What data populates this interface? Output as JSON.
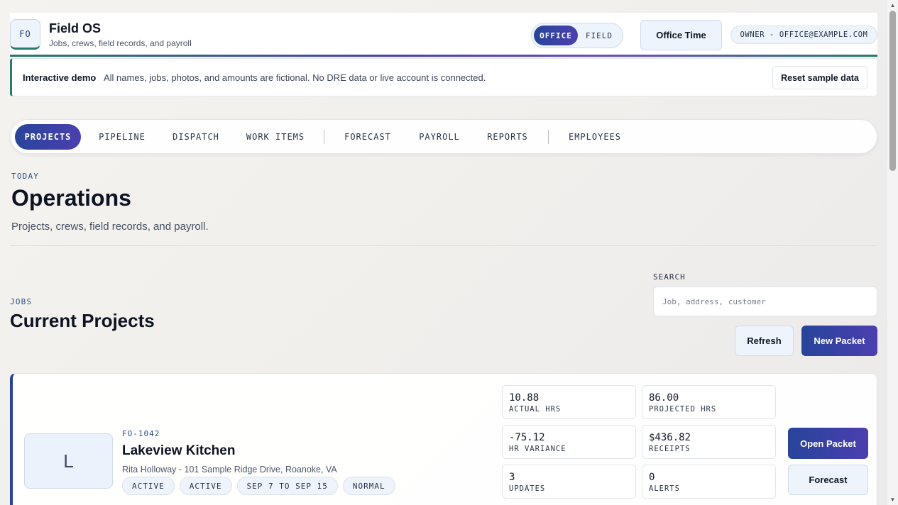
{
  "header": {
    "logo_text": "FO",
    "app_title": "Field OS",
    "app_subtitle": "Jobs, crews, field records, and payroll",
    "mode_toggle": {
      "office": "OFFICE",
      "field": "FIELD",
      "selected": "OFFICE"
    },
    "office_time_label": "Office Time",
    "owner_label": "OWNER - OFFICE@EXAMPLE.COM"
  },
  "banner": {
    "label": "Interactive demo",
    "text": "All names, jobs, photos, and amounts are fictional. No DRE data or live account is connected.",
    "reset_label": "Reset sample data"
  },
  "tabs": [
    {
      "label": "PROJECTS",
      "active": true
    },
    {
      "label": "PIPELINE",
      "active": false
    },
    {
      "label": "DISPATCH",
      "active": false
    },
    {
      "label": "WORK ITEMS",
      "active": false
    },
    {
      "label": "FORECAST",
      "active": false
    },
    {
      "label": "PAYROLL",
      "active": false
    },
    {
      "label": "REPORTS",
      "active": false
    },
    {
      "label": "EMPLOYEES",
      "active": false
    }
  ],
  "page": {
    "eyebrow": "TODAY",
    "title": "Operations",
    "subtitle": "Projects, crews, field records, and payroll."
  },
  "jobs": {
    "eyebrow": "JOBS",
    "title": "Current Projects",
    "search_label": "SEARCH",
    "search_placeholder": "Job, address, customer",
    "search_value": "",
    "refresh_label": "Refresh",
    "new_packet_label": "New Packet"
  },
  "project": {
    "avatar_letter": "L",
    "code": "FO-1042",
    "name": "Lakeview Kitchen",
    "address": "Rita Holloway - 101 Sample Ridge Drive, Roanoke, VA",
    "chips": [
      "ACTIVE",
      "ACTIVE",
      "SEP 7 TO SEP 15",
      "NORMAL"
    ],
    "stats": [
      {
        "value": "10.88",
        "label": "ACTUAL HRS"
      },
      {
        "value": "86.00",
        "label": "PROJECTED HRS"
      },
      {
        "value": "-75.12",
        "label": "HR VARIANCE"
      },
      {
        "value": "$436.82",
        "label": "RECEIPTS"
      },
      {
        "value": "3",
        "label": "UPDATES"
      },
      {
        "value": "0",
        "label": "ALERTS"
      }
    ],
    "open_packet_label": "Open Packet",
    "forecast_label": "Forecast"
  },
  "colors": {
    "accent": "#27449a",
    "accent_end": "#4b3fb0",
    "teal": "#2a7a6a",
    "chip_bg": "#eef4fb"
  }
}
